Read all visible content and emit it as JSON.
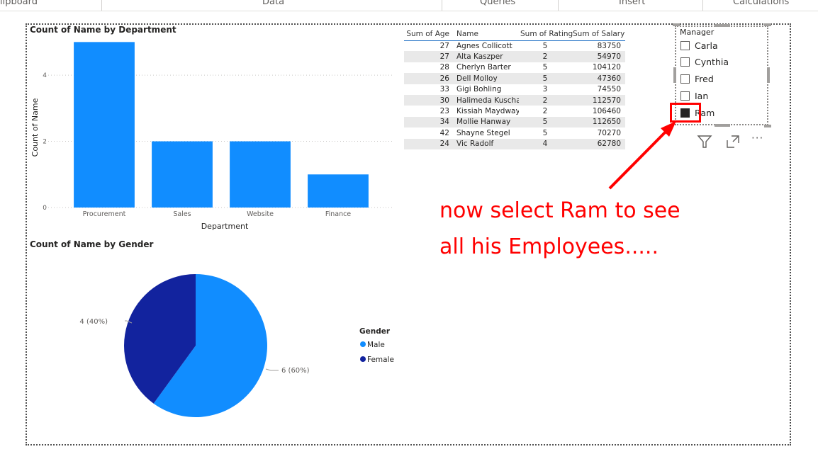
{
  "ribbon": {
    "groups": [
      "lipboard",
      "Data",
      "Queries",
      "Insert",
      "Calculations"
    ]
  },
  "bar_visual": {
    "title": "Count of Name by Department",
    "ylabel": "Count of Name",
    "xlabel": "Department",
    "bar_color": "#118DFF"
  },
  "pie_visual": {
    "title": "Count of Name by Gender",
    "legend_title": "Gender",
    "legend": [
      {
        "label": "Male",
        "color": "#118DFF"
      },
      {
        "label": "Female",
        "color": "#12239E"
      }
    ],
    "labels": {
      "female": "4 (40%)",
      "male": "6 (60%)"
    }
  },
  "table": {
    "columns": [
      "Sum of Age",
      "Name",
      "Sum of Rating",
      "Sum of Salary"
    ],
    "rows": [
      [
        "27",
        "Agnes Collicott",
        "5",
        "83750"
      ],
      [
        "27",
        "Alta Kaszper",
        "2",
        "54970"
      ],
      [
        "28",
        "Cherlyn Barter",
        "5",
        "104120"
      ],
      [
        "26",
        "Dell Molloy",
        "5",
        "47360"
      ],
      [
        "33",
        "Gigi Bohling",
        "3",
        "74550"
      ],
      [
        "30",
        "Halimeda Kuscha",
        "2",
        "112570"
      ],
      [
        "23",
        "Kissiah Maydway",
        "2",
        "106460"
      ],
      [
        "34",
        "Mollie Hanway",
        "5",
        "112650"
      ],
      [
        "42",
        "Shayne Stegel",
        "5",
        "70270"
      ],
      [
        "24",
        "Vic Radolf",
        "4",
        "62780"
      ]
    ]
  },
  "slicer": {
    "title": "Manager",
    "items": [
      {
        "label": "Carla",
        "checked": false
      },
      {
        "label": "Cynthia",
        "checked": false
      },
      {
        "label": "Fred",
        "checked": false
      },
      {
        "label": "Ian",
        "checked": false
      },
      {
        "label": "Ram",
        "checked": true
      }
    ]
  },
  "visual_header": {
    "more_label": "···"
  },
  "annotation": {
    "line1": "now select Ram to see",
    "line2": "all his Employees.....",
    "color": "#ff0000"
  },
  "chart_data": [
    {
      "type": "bar",
      "title": "Count of Name by Department",
      "xlabel": "Department",
      "ylabel": "Count of Name",
      "categories": [
        "Procurement",
        "Sales",
        "Website",
        "Finance"
      ],
      "values": [
        5,
        2,
        2,
        1
      ],
      "ylim": [
        0,
        5
      ],
      "yticks": [
        0,
        2,
        4
      ],
      "grid": true
    },
    {
      "type": "pie",
      "title": "Count of Name by Gender",
      "categories": [
        "Male",
        "Female"
      ],
      "values": [
        6,
        4
      ],
      "legend_title": "Gender",
      "legend_position": "right"
    }
  ]
}
